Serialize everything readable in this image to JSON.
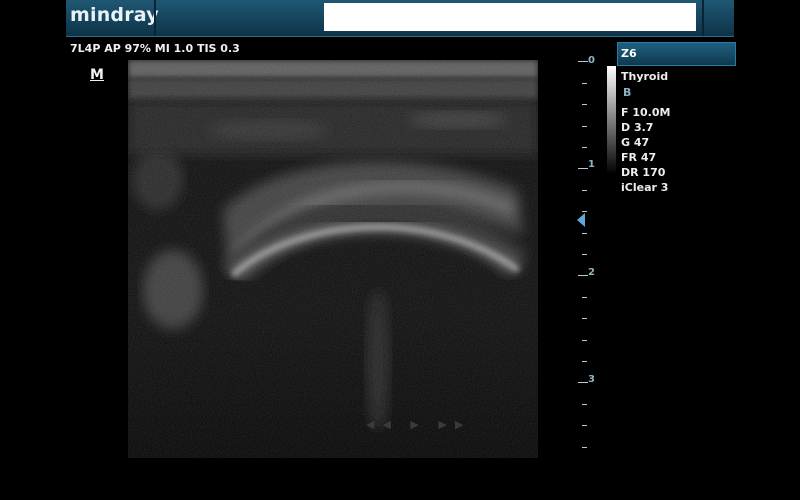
{
  "brand": "mindray",
  "patient_field": "",
  "params": "7L4P  AP 97%  MI 1.0  TIS 0.3",
  "orientation_mark": "M",
  "depth_labels": [
    "0",
    "1",
    "2",
    "3"
  ],
  "panel": {
    "zoom": "Z6",
    "exam": "Thyroid",
    "mode": "B",
    "frequency": "F 10.0M",
    "depth": "D 3.7",
    "gain": "G 47",
    "frame_rate": "FR 47",
    "dynamic_range": "DR 170",
    "iclear": "iClear 3"
  },
  "playback_controls": "◀◀ ▶ ▶▶",
  "colors": {
    "topbar": "#1f5873",
    "accent": "#5fa8d3",
    "depth_label": "#8fb4c6"
  },
  "icons": [
    "focus-marker-icon",
    "play-icon",
    "rewind-icon",
    "fast-forward-icon"
  ]
}
